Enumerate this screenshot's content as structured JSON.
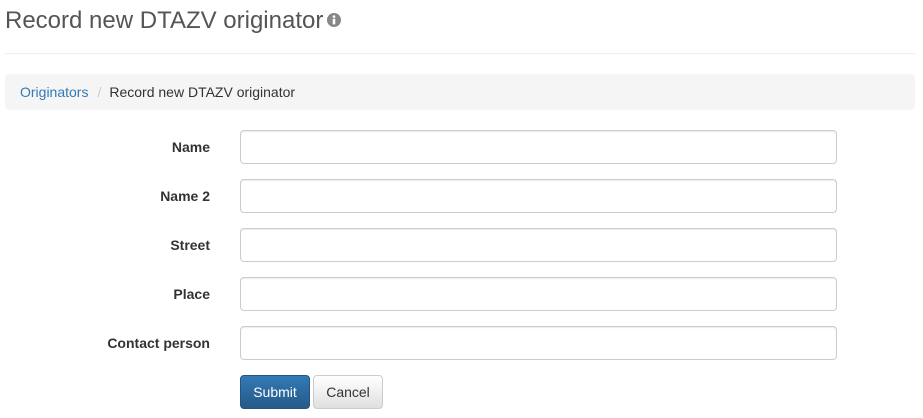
{
  "header": {
    "title": "Record new DTAZV originator",
    "info_icon": "info-circle-icon"
  },
  "breadcrumb": {
    "items": [
      {
        "label": "Originators"
      },
      {
        "label": "Record new DTAZV originator"
      }
    ],
    "separator": "/"
  },
  "form": {
    "fields": [
      {
        "label": "Name",
        "value": "",
        "placeholder": ""
      },
      {
        "label": "Name 2",
        "value": "",
        "placeholder": ""
      },
      {
        "label": "Street",
        "value": "",
        "placeholder": ""
      },
      {
        "label": "Place",
        "value": "",
        "placeholder": ""
      },
      {
        "label": "Contact person",
        "value": "",
        "placeholder": ""
      }
    ],
    "submit_label": "Submit",
    "cancel_label": "Cancel"
  },
  "colors": {
    "link": "#337ab7",
    "primary_button": "#337ab7",
    "breadcrumb_bg": "#f5f5f5"
  }
}
